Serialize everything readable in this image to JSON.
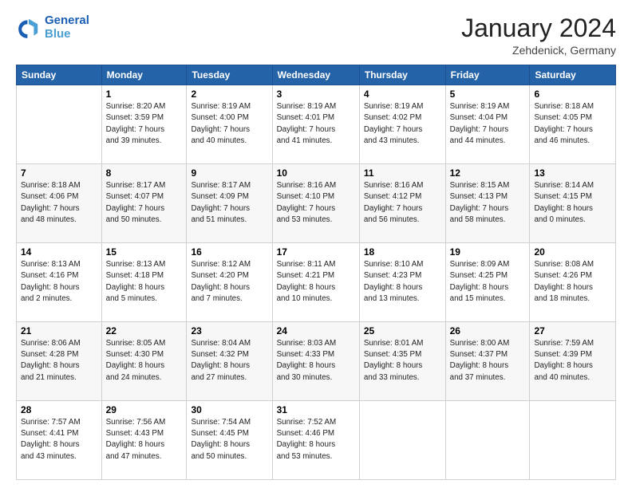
{
  "header": {
    "logo_line1": "General",
    "logo_line2": "Blue",
    "title": "January 2024",
    "subtitle": "Zehdenick, Germany"
  },
  "calendar": {
    "headers": [
      "Sunday",
      "Monday",
      "Tuesday",
      "Wednesday",
      "Thursday",
      "Friday",
      "Saturday"
    ],
    "weeks": [
      [
        {
          "day": "",
          "info": ""
        },
        {
          "day": "1",
          "info": "Sunrise: 8:20 AM\nSunset: 3:59 PM\nDaylight: 7 hours\nand 39 minutes."
        },
        {
          "day": "2",
          "info": "Sunrise: 8:19 AM\nSunset: 4:00 PM\nDaylight: 7 hours\nand 40 minutes."
        },
        {
          "day": "3",
          "info": "Sunrise: 8:19 AM\nSunset: 4:01 PM\nDaylight: 7 hours\nand 41 minutes."
        },
        {
          "day": "4",
          "info": "Sunrise: 8:19 AM\nSunset: 4:02 PM\nDaylight: 7 hours\nand 43 minutes."
        },
        {
          "day": "5",
          "info": "Sunrise: 8:19 AM\nSunset: 4:04 PM\nDaylight: 7 hours\nand 44 minutes."
        },
        {
          "day": "6",
          "info": "Sunrise: 8:18 AM\nSunset: 4:05 PM\nDaylight: 7 hours\nand 46 minutes."
        }
      ],
      [
        {
          "day": "7",
          "info": "Sunrise: 8:18 AM\nSunset: 4:06 PM\nDaylight: 7 hours\nand 48 minutes."
        },
        {
          "day": "8",
          "info": "Sunrise: 8:17 AM\nSunset: 4:07 PM\nDaylight: 7 hours\nand 50 minutes."
        },
        {
          "day": "9",
          "info": "Sunrise: 8:17 AM\nSunset: 4:09 PM\nDaylight: 7 hours\nand 51 minutes."
        },
        {
          "day": "10",
          "info": "Sunrise: 8:16 AM\nSunset: 4:10 PM\nDaylight: 7 hours\nand 53 minutes."
        },
        {
          "day": "11",
          "info": "Sunrise: 8:16 AM\nSunset: 4:12 PM\nDaylight: 7 hours\nand 56 minutes."
        },
        {
          "day": "12",
          "info": "Sunrise: 8:15 AM\nSunset: 4:13 PM\nDaylight: 7 hours\nand 58 minutes."
        },
        {
          "day": "13",
          "info": "Sunrise: 8:14 AM\nSunset: 4:15 PM\nDaylight: 8 hours\nand 0 minutes."
        }
      ],
      [
        {
          "day": "14",
          "info": "Sunrise: 8:13 AM\nSunset: 4:16 PM\nDaylight: 8 hours\nand 2 minutes."
        },
        {
          "day": "15",
          "info": "Sunrise: 8:13 AM\nSunset: 4:18 PM\nDaylight: 8 hours\nand 5 minutes."
        },
        {
          "day": "16",
          "info": "Sunrise: 8:12 AM\nSunset: 4:20 PM\nDaylight: 8 hours\nand 7 minutes."
        },
        {
          "day": "17",
          "info": "Sunrise: 8:11 AM\nSunset: 4:21 PM\nDaylight: 8 hours\nand 10 minutes."
        },
        {
          "day": "18",
          "info": "Sunrise: 8:10 AM\nSunset: 4:23 PM\nDaylight: 8 hours\nand 13 minutes."
        },
        {
          "day": "19",
          "info": "Sunrise: 8:09 AM\nSunset: 4:25 PM\nDaylight: 8 hours\nand 15 minutes."
        },
        {
          "day": "20",
          "info": "Sunrise: 8:08 AM\nSunset: 4:26 PM\nDaylight: 8 hours\nand 18 minutes."
        }
      ],
      [
        {
          "day": "21",
          "info": "Sunrise: 8:06 AM\nSunset: 4:28 PM\nDaylight: 8 hours\nand 21 minutes."
        },
        {
          "day": "22",
          "info": "Sunrise: 8:05 AM\nSunset: 4:30 PM\nDaylight: 8 hours\nand 24 minutes."
        },
        {
          "day": "23",
          "info": "Sunrise: 8:04 AM\nSunset: 4:32 PM\nDaylight: 8 hours\nand 27 minutes."
        },
        {
          "day": "24",
          "info": "Sunrise: 8:03 AM\nSunset: 4:33 PM\nDaylight: 8 hours\nand 30 minutes."
        },
        {
          "day": "25",
          "info": "Sunrise: 8:01 AM\nSunset: 4:35 PM\nDaylight: 8 hours\nand 33 minutes."
        },
        {
          "day": "26",
          "info": "Sunrise: 8:00 AM\nSunset: 4:37 PM\nDaylight: 8 hours\nand 37 minutes."
        },
        {
          "day": "27",
          "info": "Sunrise: 7:59 AM\nSunset: 4:39 PM\nDaylight: 8 hours\nand 40 minutes."
        }
      ],
      [
        {
          "day": "28",
          "info": "Sunrise: 7:57 AM\nSunset: 4:41 PM\nDaylight: 8 hours\nand 43 minutes."
        },
        {
          "day": "29",
          "info": "Sunrise: 7:56 AM\nSunset: 4:43 PM\nDaylight: 8 hours\nand 47 minutes."
        },
        {
          "day": "30",
          "info": "Sunrise: 7:54 AM\nSunset: 4:45 PM\nDaylight: 8 hours\nand 50 minutes."
        },
        {
          "day": "31",
          "info": "Sunrise: 7:52 AM\nSunset: 4:46 PM\nDaylight: 8 hours\nand 53 minutes."
        },
        {
          "day": "",
          "info": ""
        },
        {
          "day": "",
          "info": ""
        },
        {
          "day": "",
          "info": ""
        }
      ]
    ]
  }
}
